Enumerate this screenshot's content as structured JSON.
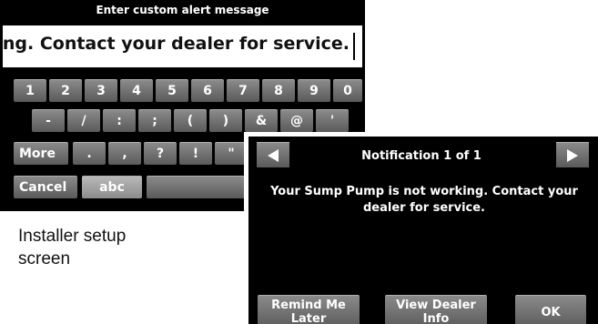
{
  "setup_screen": {
    "title": "Enter custom alert message",
    "message_value": "orking. Contact your dealer for service.",
    "keyboard": {
      "row1": [
        "1",
        "2",
        "3",
        "4",
        "5",
        "6",
        "7",
        "8",
        "9",
        "0"
      ],
      "row2": [
        "-",
        "/",
        ":",
        ";",
        "(",
        ")",
        "&",
        "@",
        "'"
      ],
      "row3": [
        "More",
        ".",
        ",",
        "?",
        "!",
        "\""
      ],
      "row4": [
        "Cancel",
        "abc",
        "Space"
      ]
    }
  },
  "caption": {
    "line1": "Installer setup",
    "line2": "screen"
  },
  "notification": {
    "title": "Notification 1 of 1",
    "body": "Your Sump Pump is not working. Contact your dealer for service.",
    "buttons": {
      "remind_line1": "Remind Me",
      "remind_line2": "Later",
      "dealer_line1": "View Dealer",
      "dealer_line2": "Info",
      "ok": "OK"
    }
  }
}
